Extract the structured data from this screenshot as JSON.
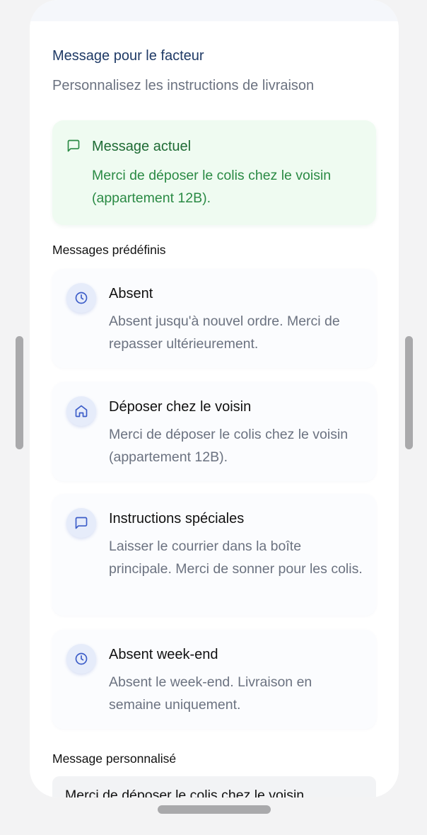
{
  "header": {
    "title": "Message pour le facteur",
    "subtitle": "Personnalisez les instructions de livraison"
  },
  "current_message": {
    "icon": "message-square-icon",
    "title": "Message actuel",
    "text": "Merci de déposer le colis chez le voisin (appartement 12B).",
    "color": "#2a8a44"
  },
  "predefined": {
    "label": "Messages prédéfinis",
    "items": [
      {
        "icon": "clock-icon",
        "title": "Absent",
        "text": "Absent jusqu'à nouvel ordre. Merci de repasser ultérieurement."
      },
      {
        "icon": "home-icon",
        "title": "Déposer chez le voisin",
        "text": "Merci de déposer le colis chez le voisin (appartement 12B)."
      },
      {
        "icon": "message-square-icon",
        "title": "Instructions spéciales",
        "text": "Laisser le courrier dans la boîte principale. Merci de sonner pour les colis."
      },
      {
        "icon": "clock-icon",
        "title": "Absent week-end",
        "text": "Absent le week-end. Livraison en semaine uniquement."
      }
    ]
  },
  "custom": {
    "label": "Message personnalisé",
    "value": "Merci de déposer le colis chez le voisin"
  },
  "colors": {
    "accent": "#3b5cc8",
    "title": "#1f3a66",
    "success_bg": "#effbf1"
  }
}
